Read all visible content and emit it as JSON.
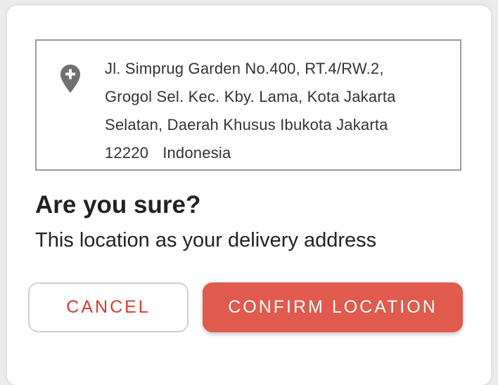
{
  "address": {
    "line1": "Jl. Simprug Garden No.400, RT.4/RW.2,",
    "line2": "Grogol Sel. Kec. Kby. Lama, Kota Jakarta",
    "line3": "Selatan, Daerah Khusus Ibukota Jakarta",
    "postal_code": "12220",
    "country": "Indonesia",
    "icon": "location-pin-plus-icon"
  },
  "dialog": {
    "title": "Are you sure?",
    "subtitle": "This location as your delivery address"
  },
  "buttons": {
    "cancel_label": "CANCEL",
    "confirm_label": "CONFIRM LOCATION"
  },
  "colors": {
    "accent": "#e05a4d",
    "cancel_text": "#cf3d2e",
    "pin_icon": "#707070"
  }
}
